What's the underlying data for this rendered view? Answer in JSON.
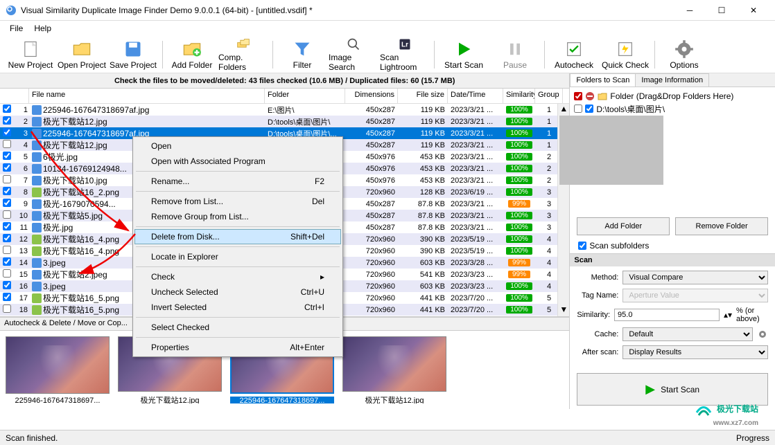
{
  "window": {
    "title": "Visual Similarity Duplicate Image Finder Demo 9.0.0.1 (64-bit) - [untitled.vsdif] *"
  },
  "menu": {
    "file": "File",
    "help": "Help"
  },
  "toolbar": {
    "new_project": "New Project",
    "open_project": "Open Project",
    "save_project": "Save Project",
    "add_folder": "Add Folder",
    "comp_folders": "Comp. Folders",
    "filter": "Filter",
    "image_search": "Image Search",
    "scan_lightroom": "Scan Lightroom",
    "start_scan": "Start Scan",
    "pause": "Pause",
    "autocheck": "Autocheck",
    "quick_check": "Quick Check",
    "options": "Options"
  },
  "infobar": "Check the files to be moved/deleted: 43 files checked (10.6 MB) / Duplicated files: 60 (15.7 MB)",
  "columns": {
    "file_name": "File name",
    "folder": "Folder",
    "dimensions": "Dimensions",
    "file_size": "File size",
    "date_time": "Date/Time",
    "similarity": "Similarity",
    "group": "Group"
  },
  "rows": [
    {
      "n": 1,
      "chk": true,
      "name": "225946-1676473186​97af.jpg",
      "folder": "E:\\图片\\",
      "dims": "450x287",
      "size": "119 KB",
      "dt": "2023/3/21 ...",
      "sim": "100%",
      "grp": 1,
      "alt": false,
      "type": "jpg"
    },
    {
      "n": 2,
      "chk": true,
      "name": "极光下载站12.jpg",
      "folder": "D:\\tools\\桌面\\图片\\",
      "dims": "450x287",
      "size": "119 KB",
      "dt": "2023/3/21 ...",
      "sim": "100%",
      "grp": 1,
      "alt": true,
      "type": "jpg"
    },
    {
      "n": 3,
      "chk": true,
      "name": "225946-1676473186​97af.jpg",
      "folder": "D:\\tools\\桌面\\图片\\...",
      "dims": "450x287",
      "size": "119 KB",
      "dt": "2023/3/21 ...",
      "sim": "100%",
      "grp": 1,
      "alt": false,
      "sel": true,
      "type": "jpg"
    },
    {
      "n": 4,
      "chk": false,
      "name": "极光下载站12.jpg",
      "folder": "",
      "dims": "450x287",
      "size": "119 KB",
      "dt": "2023/3/21 ...",
      "sim": "100%",
      "grp": 1,
      "alt": true,
      "type": "jpg"
    },
    {
      "n": 5,
      "chk": true,
      "name": "6极光.jpg",
      "folder": "",
      "dims": "450x976",
      "size": "453 KB",
      "dt": "2023/3/21 ...",
      "sim": "100%",
      "grp": 2,
      "alt": false,
      "type": "jpg"
    },
    {
      "n": 6,
      "chk": true,
      "name": "10134-167691249​48...",
      "folder": "",
      "dims": "450x976",
      "size": "453 KB",
      "dt": "2023/3/21 ...",
      "sim": "100%",
      "grp": 2,
      "alt": true,
      "type": "jpg"
    },
    {
      "n": 7,
      "chk": false,
      "name": "极光下载站10.jpg",
      "folder": "",
      "dims": "450x976",
      "size": "453 KB",
      "dt": "2023/3/21 ...",
      "sim": "100%",
      "grp": 2,
      "alt": false,
      "type": "jpg"
    },
    {
      "n": 8,
      "chk": true,
      "name": "极光下载站16_2.png",
      "folder": "",
      "dims": "720x960",
      "size": "128 KB",
      "dt": "2023/6/19 ...",
      "sim": "100%",
      "grp": 3,
      "alt": true,
      "type": "png"
    },
    {
      "n": 9,
      "chk": true,
      "name": "极光-167907059​4...",
      "folder": "",
      "dims": "450x287",
      "size": "87.8 KB",
      "dt": "2023/3/21 ...",
      "sim": "99%",
      "grp": 3,
      "alt": false,
      "type": "jpg"
    },
    {
      "n": 10,
      "chk": false,
      "name": "极光下载站5.jpg",
      "folder": "",
      "dims": "450x287",
      "size": "87.8 KB",
      "dt": "2023/3/21 ...",
      "sim": "100%",
      "grp": 3,
      "alt": true,
      "type": "jpg"
    },
    {
      "n": 11,
      "chk": true,
      "name": "极光.jpg",
      "folder": "",
      "dims": "450x287",
      "size": "87.8 KB",
      "dt": "2023/3/21 ...",
      "sim": "100%",
      "grp": 3,
      "alt": false,
      "type": "jpg"
    },
    {
      "n": 12,
      "chk": true,
      "name": "极光下载站16_4.png",
      "folder": "",
      "dims": "720x960",
      "size": "390 KB",
      "dt": "2023/5/19 ...",
      "sim": "100%",
      "grp": 4,
      "alt": true,
      "type": "png"
    },
    {
      "n": 13,
      "chk": false,
      "name": "极光下载站16_4.png",
      "folder": "",
      "dims": "720x960",
      "size": "390 KB",
      "dt": "2023/5/19 ...",
      "sim": "100%",
      "grp": 4,
      "alt": false,
      "type": "png"
    },
    {
      "n": 14,
      "chk": true,
      "name": "3.jpeg",
      "folder": "",
      "dims": "720x960",
      "size": "603 KB",
      "dt": "2023/3/28 ...",
      "sim": "99%",
      "grp": 4,
      "alt": true,
      "type": "jpg"
    },
    {
      "n": 15,
      "chk": false,
      "name": "极光下载站2.jpeg",
      "folder": "",
      "dims": "720x960",
      "size": "541 KB",
      "dt": "2023/3/23 ...",
      "sim": "99%",
      "grp": 4,
      "alt": false,
      "type": "jpg"
    },
    {
      "n": 16,
      "chk": true,
      "name": "3.jpeg",
      "folder": "",
      "dims": "720x960",
      "size": "603 KB",
      "dt": "2023/3/23 ...",
      "sim": "100%",
      "grp": 4,
      "alt": true,
      "type": "jpg"
    },
    {
      "n": 17,
      "chk": true,
      "name": "极光下载站16_5.png",
      "folder": "",
      "dims": "720x960",
      "size": "441 KB",
      "dt": "2023/7/20 ...",
      "sim": "100%",
      "grp": 5,
      "alt": false,
      "type": "png"
    },
    {
      "n": 18,
      "chk": false,
      "name": "极光下载站16_5.png",
      "folder": "",
      "dims": "720x960",
      "size": "441 KB",
      "dt": "2023/7/20 ...",
      "sim": "100%",
      "grp": 5,
      "alt": true,
      "type": "png"
    }
  ],
  "context_menu": {
    "open": "Open",
    "open_assoc": "Open with Associated Program",
    "rename": "Rename...",
    "rename_key": "F2",
    "remove_list": "Remove from List...",
    "remove_list_key": "Del",
    "remove_group": "Remove Group from List...",
    "delete_disk": "Delete from Disk...",
    "delete_disk_key": "Shift+Del",
    "locate": "Locate in Explorer",
    "check": "Check",
    "uncheck_sel": "Uncheck Selected",
    "uncheck_sel_key": "Ctrl+U",
    "invert_sel": "Invert Selected",
    "invert_sel_key": "Ctrl+I",
    "select_checked": "Select Checked",
    "properties": "Properties",
    "properties_key": "Alt+Enter"
  },
  "autocheck_bar": "Autocheck & Delete / Move or Cop...",
  "thumbs": [
    {
      "name": "225946-167647318697...",
      "sel": false
    },
    {
      "name": "极光下载站12.jpg",
      "sel": false
    },
    {
      "name": "225946-167647318697...",
      "sel": true
    },
    {
      "name": "极光下载站12.jpg",
      "sel": false
    }
  ],
  "right": {
    "tab_folders": "Folders to Scan",
    "tab_info": "Image Information",
    "folder_hint": "Folder (Drag&Drop Folders Here)",
    "folder1": "D:\\tools\\桌面\\图片\\",
    "add_folder": "Add Folder",
    "remove_folder": "Remove Folder",
    "scan_sub": "Scan subfolders",
    "scan_head": "Scan",
    "method": "Method:",
    "method_val": "Visual Compare",
    "tag": "Tag Name:",
    "tag_val": "Aperture Value",
    "similarity": "Similarity:",
    "similarity_val": "95.0",
    "similarity_pct": "% (or above)",
    "cache": "Cache:",
    "cache_val": "Default",
    "after": "After scan:",
    "after_val": "Display Results",
    "start_scan": "Start Scan"
  },
  "status": {
    "left": "Scan finished.",
    "right": "Progress"
  },
  "watermark": {
    "name": "极光下载站",
    "url": "www.xz7.com"
  }
}
